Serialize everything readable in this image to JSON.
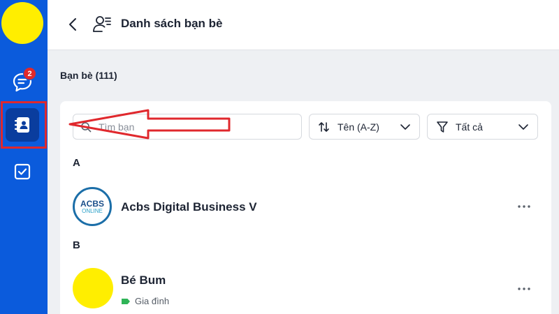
{
  "nav": {
    "chat_badge": "2"
  },
  "header": {
    "title": "Danh sách bạn bè"
  },
  "friends": {
    "count_label": "Bạn bè (111)",
    "search_placeholder": "Tìm bạn",
    "sort": {
      "selected": "Tên (A-Z)"
    },
    "filter": {
      "selected": "Tất cả"
    },
    "sections": [
      {
        "letter": "A",
        "contacts": [
          {
            "name": "Acbs Digital Business V",
            "avatar": "acbs-logo",
            "logo_line1": "ACBS",
            "logo_line2": "ONLINE"
          }
        ]
      },
      {
        "letter": "B",
        "contacts": [
          {
            "name": "Bé Bum",
            "avatar": "yellow-circle",
            "tag": "Gia đình",
            "tag_color": "#2fb457"
          }
        ]
      }
    ]
  },
  "colors": {
    "rail": "#0b5bdc",
    "rail_active": "#0a3d9e",
    "annotation_red": "#e0282d"
  }
}
